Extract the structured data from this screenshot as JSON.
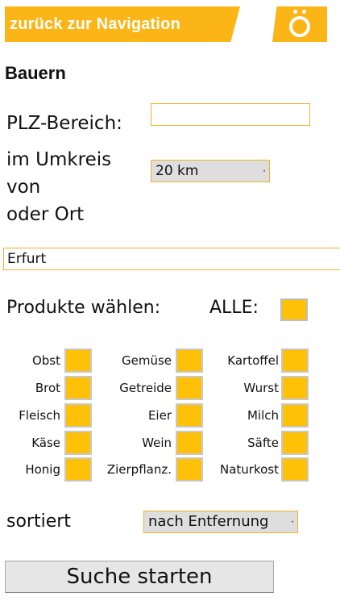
{
  "header": {
    "nav_label": "zurück zur Navigation",
    "logo_text": "ö"
  },
  "title": "Bauern",
  "form": {
    "plz_label": "PLZ-Bereich:",
    "plz_value": "",
    "umkreis_line1": "im Umkreis",
    "umkreis_line2": "von",
    "umkreis_line3": "oder Ort",
    "radius_value": "20 km",
    "ort_value": "Erfurt",
    "produkte_label": "Produkte wählen:",
    "alle_label": "ALLE:",
    "products": [
      [
        "Obst",
        "Gemüse",
        "Kartoffel"
      ],
      [
        "Brot",
        "Getreide",
        "Wurst"
      ],
      [
        "Fleisch",
        "Eier",
        "Milch"
      ],
      [
        "Käse",
        "Wein",
        "Säfte"
      ],
      [
        "Honig",
        "Zierpflanz.",
        "Naturkost"
      ]
    ],
    "sort_label": "sortiert",
    "sort_value": "nach Entfernung",
    "search_button": "Suche starten"
  },
  "colors": {
    "accent": "#fbb516",
    "checkbox": "#ffc107",
    "border": "#f2b12a"
  }
}
